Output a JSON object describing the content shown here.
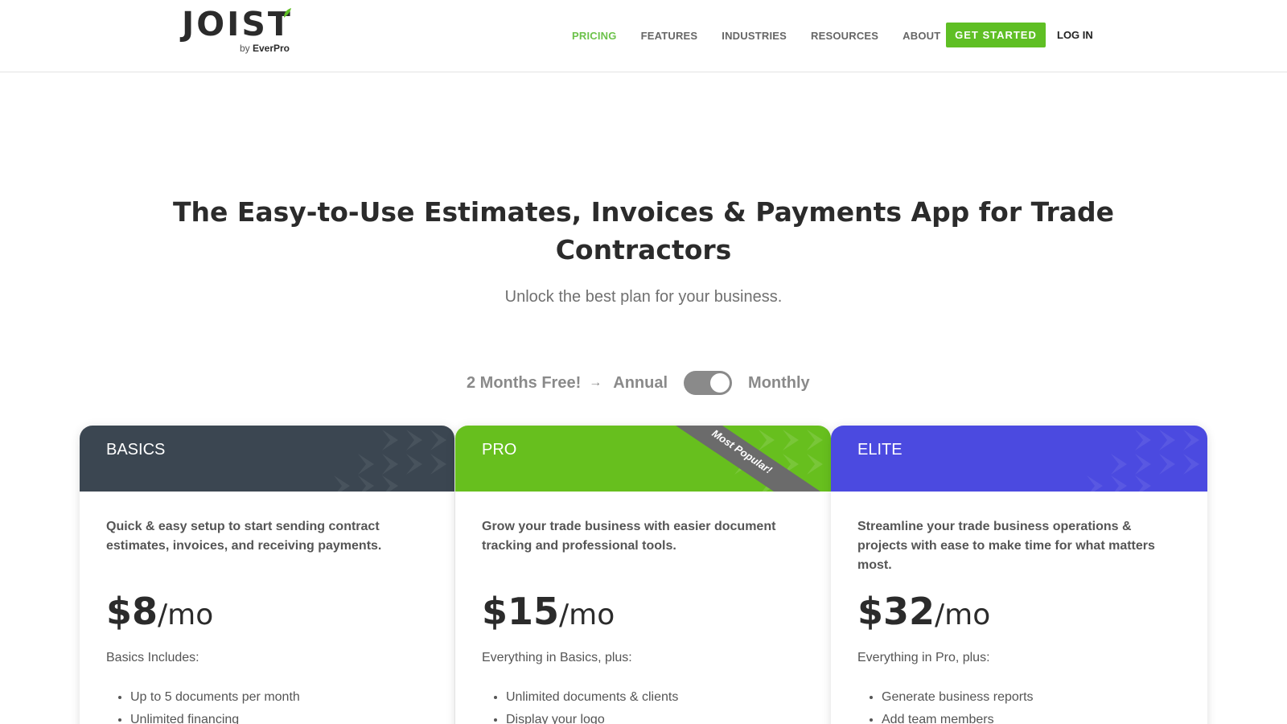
{
  "brand": {
    "name": "JOIST",
    "by": "by",
    "company": "EverPro"
  },
  "nav": {
    "items": [
      {
        "label": "PRICING",
        "active": true
      },
      {
        "label": "FEATURES",
        "active": false
      },
      {
        "label": "INDUSTRIES",
        "active": false
      },
      {
        "label": "RESOURCES",
        "active": false
      },
      {
        "label": "ABOUT",
        "active": false
      }
    ],
    "cta_label": "GET STARTED",
    "login_label": "LOG IN"
  },
  "hero": {
    "title": "The Easy-to-Use Estimates, Invoices & Payments App for Trade Contractors",
    "subtitle": "Unlock the best plan for your business."
  },
  "billing": {
    "promo": "2 Months Free!",
    "arrow_icon": "arrow-right-icon",
    "annual_label": "Annual",
    "monthly_label": "Monthly",
    "selected": "Monthly"
  },
  "plans": [
    {
      "name": "BASICS",
      "color": "#3b4651",
      "description": "Quick & easy setup to start sending contract estimates, invoices, and receiving payments.",
      "price": "$8",
      "unit": "/mo",
      "includes": "Basics Includes:",
      "features": [
        "Up to 5 documents per month",
        "Unlimited financing"
      ]
    },
    {
      "name": "PRO",
      "color": "#67bf1e",
      "badge": "Most Popular!",
      "description": "Grow your trade business with easier document tracking and professional tools.",
      "price": "$15",
      "unit": "/mo",
      "includes": "Everything in Basics, plus:",
      "features": [
        "Unlimited documents & clients",
        "Display your logo"
      ]
    },
    {
      "name": "ELITE",
      "color": "#4b4ae0",
      "description": "Streamline your trade business operations & projects with ease to make time for what matters most.",
      "price": "$32",
      "unit": "/mo",
      "includes": "Everything in Pro, plus:",
      "features": [
        "Generate business reports",
        "Add team members"
      ]
    }
  ]
}
